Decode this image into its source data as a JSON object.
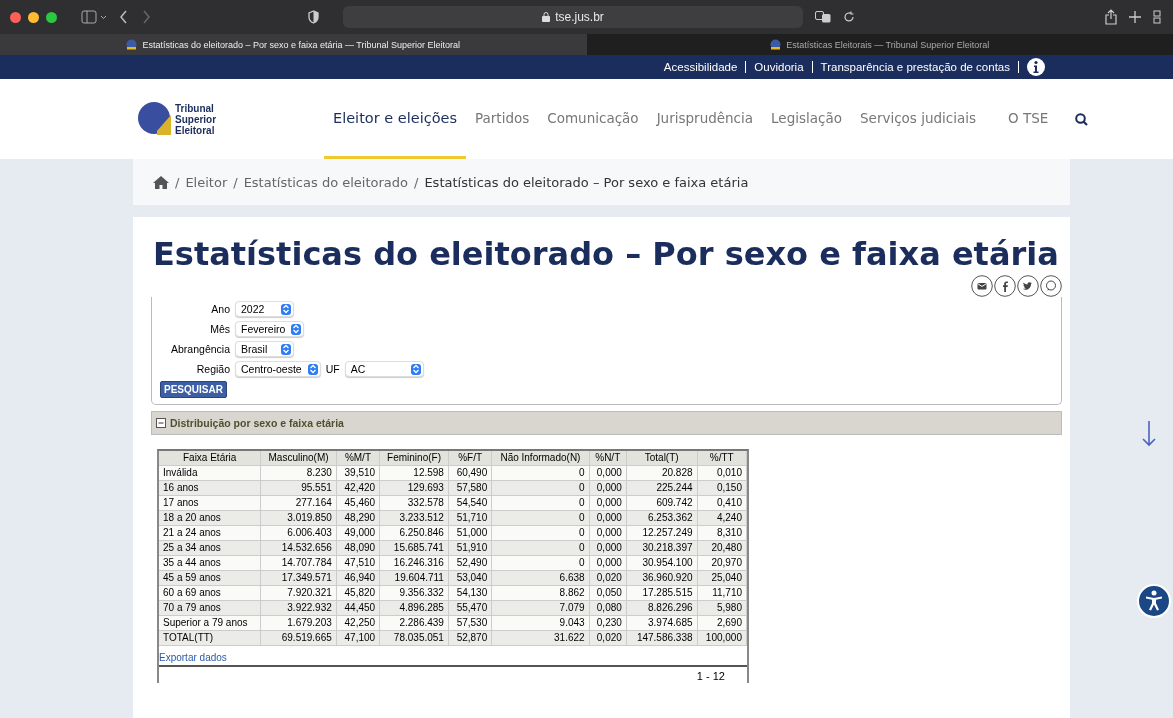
{
  "browser": {
    "url": "tse.jus.br",
    "tabs": [
      {
        "title": "Estatísticas do eleitorado – Por sexo e faixa etária — Tribunal Superior Eleitoral",
        "selected": true
      },
      {
        "title": "Estatísticas Eleitorais — Tribunal Superior Eleitoral",
        "selected": false
      }
    ]
  },
  "top_bar": {
    "links": [
      "Acessibilidade",
      "Ouvidoria",
      "Transparência e prestação de contas"
    ]
  },
  "header": {
    "logo_lines": [
      "Tribunal",
      "Superior",
      "Eleitoral"
    ],
    "nav": [
      {
        "label": "Eleitor e eleições",
        "selected": true
      },
      {
        "label": "Partidos",
        "selected": false
      },
      {
        "label": "Comunicação",
        "selected": false
      },
      {
        "label": "Jurisprudência",
        "selected": false
      },
      {
        "label": "Legislação",
        "selected": false
      },
      {
        "label": "Serviços judiciais",
        "selected": false
      },
      {
        "label": "O TSE",
        "selected": false
      }
    ]
  },
  "breadcrumb_separator": "/",
  "breadcrumb": [
    "Eleitor",
    "Estatísticas do eleitorado",
    "Estatísticas do eleitorado – Por sexo e faixa etária"
  ],
  "title": "Estatísticas do eleitorado – Por sexo e faixa etária",
  "form": {
    "fields": [
      {
        "label": "Ano",
        "value": "2022"
      },
      {
        "label": "Mês",
        "value": "Fevereiro"
      },
      {
        "label": "Abrangência",
        "value": "Brasil"
      },
      {
        "label": "Região",
        "value": "Centro-oeste",
        "extra_label": "UF",
        "extra_value": "AC"
      }
    ],
    "button": "PESQUISAR"
  },
  "panel": {
    "title": "Distribuição por sexo e faixa etária",
    "expanded": true
  },
  "table": {
    "columns": [
      "Faixa Etária",
      "Masculino(M)",
      "%M/T",
      "Feminino(F)",
      "%F/T",
      "Não Informado(N)",
      "%N/T",
      "Total(T)",
      "%/TT"
    ],
    "rows": [
      [
        "Inválida",
        "8.230",
        "39,510",
        "12.598",
        "60,490",
        "0",
        "0,000",
        "20.828",
        "0,010"
      ],
      [
        "16 anos",
        "95.551",
        "42,420",
        "129.693",
        "57,580",
        "0",
        "0,000",
        "225.244",
        "0,150"
      ],
      [
        "17 anos",
        "277.164",
        "45,460",
        "332.578",
        "54,540",
        "0",
        "0,000",
        "609.742",
        "0,410"
      ],
      [
        "18 a 20 anos",
        "3.019.850",
        "48,290",
        "3.233.512",
        "51,710",
        "0",
        "0,000",
        "6.253.362",
        "4,240"
      ],
      [
        "21 a 24 anos",
        "6.006.403",
        "49,000",
        "6.250.846",
        "51,000",
        "0",
        "0,000",
        "12.257.249",
        "8,310"
      ],
      [
        "25 a 34 anos",
        "14.532.656",
        "48,090",
        "15.685.741",
        "51,910",
        "0",
        "0,000",
        "30.218.397",
        "20,480"
      ],
      [
        "35 a 44 anos",
        "14.707.784",
        "47,510",
        "16.246.316",
        "52,490",
        "0",
        "0,000",
        "30.954.100",
        "20,970"
      ],
      [
        "45 a 59 anos",
        "17.349.571",
        "46,940",
        "19.604.711",
        "53,040",
        "6.638",
        "0,020",
        "36.960.920",
        "25,040"
      ],
      [
        "60 a 69 anos",
        "7.920.321",
        "45,820",
        "9.356.332",
        "54,130",
        "8.862",
        "0,050",
        "17.285.515",
        "11,710"
      ],
      [
        "70 a 79 anos",
        "3.922.932",
        "44,450",
        "4.896.285",
        "55,470",
        "7.079",
        "0,080",
        "8.826.296",
        "5,980"
      ],
      [
        "Superior a 79 anos",
        "1.679.203",
        "42,250",
        "2.286.439",
        "57,530",
        "9.043",
        "0,230",
        "3.974.685",
        "2,690"
      ],
      [
        "TOTAL(TT)",
        "69.519.665",
        "47,100",
        "78.035.051",
        "52,870",
        "31.622",
        "0,020",
        "147.586.338",
        "100,000"
      ]
    ],
    "export_link": "Exportar dados",
    "pagination": "1 - 12"
  }
}
